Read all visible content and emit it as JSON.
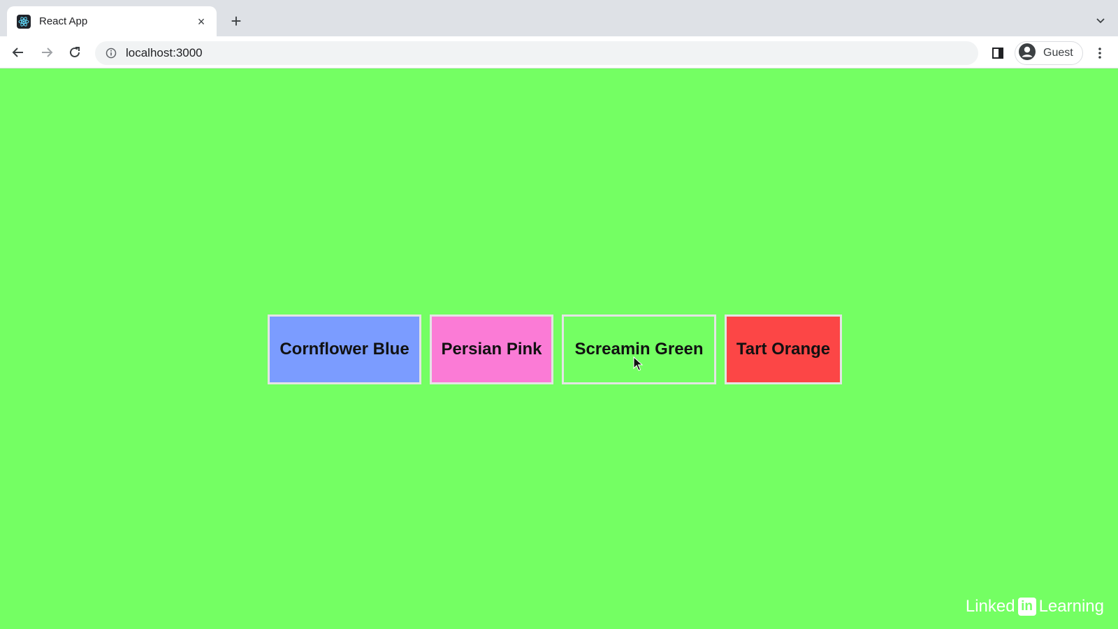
{
  "browser": {
    "tab": {
      "title": "React App",
      "close_glyph": "×",
      "favicon_icon": "react-logo-icon"
    },
    "new_tab_glyph": "+",
    "url": "localhost:3000",
    "profile": {
      "label": "Guest"
    }
  },
  "page": {
    "background_color": "#74ff63",
    "buttons": [
      {
        "label": "Cornflower Blue",
        "color": "#7b9cff"
      },
      {
        "label": "Persian Pink",
        "color": "#fb7bd6"
      },
      {
        "label": "Screamin Green",
        "color": "#74ff63"
      },
      {
        "label": "Tart Orange",
        "color": "#fc4646"
      }
    ]
  },
  "watermark": {
    "left": "Linked",
    "logo": "in",
    "right": "Learning"
  }
}
